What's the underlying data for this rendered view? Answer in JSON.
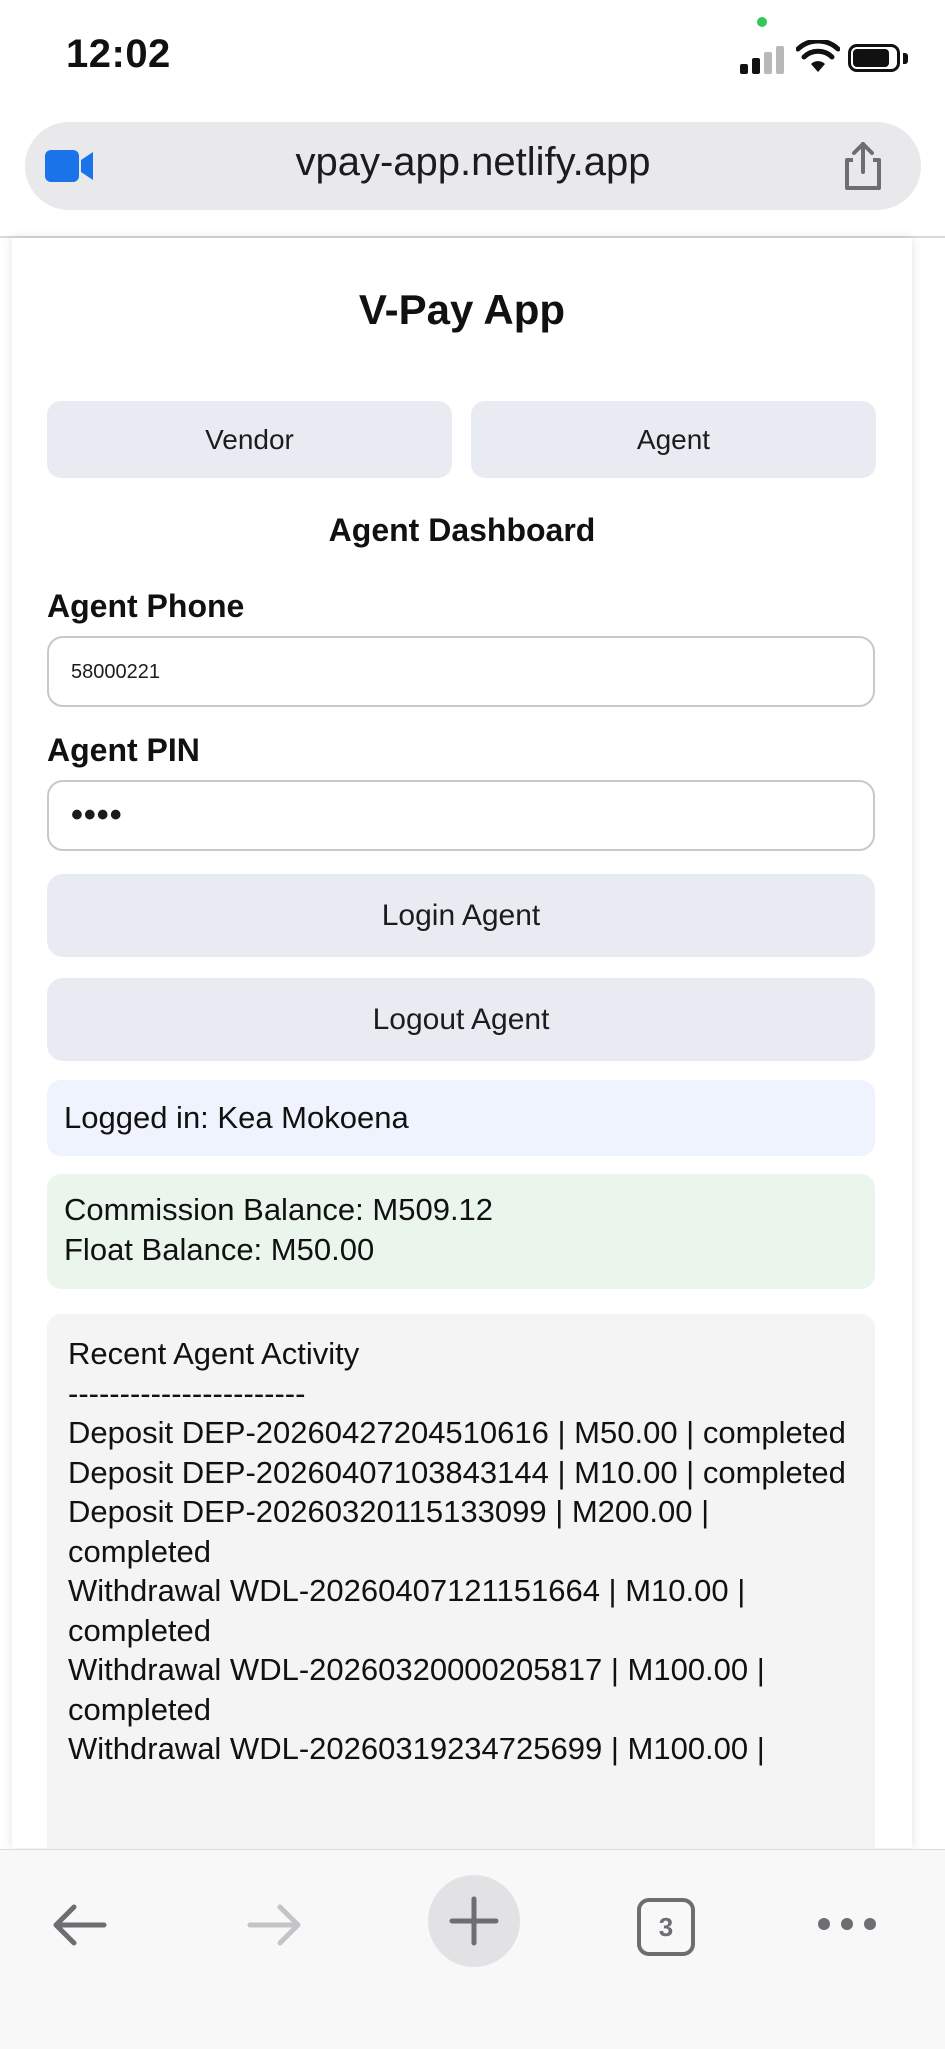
{
  "status_bar": {
    "time": "12:02"
  },
  "browser": {
    "url": "vpay-app.netlify.app",
    "tab_count": "3"
  },
  "app": {
    "title": "V-Pay App",
    "tabs": [
      {
        "label": "Vendor"
      },
      {
        "label": "Agent"
      }
    ],
    "dashboard_title": "Agent Dashboard",
    "phone": {
      "label": "Agent Phone",
      "value": "58000221"
    },
    "pin": {
      "label": "Agent PIN",
      "value": "••••"
    },
    "login_button": "Login Agent",
    "logout_button": "Logout Agent",
    "logged_in_text": "Logged in: Kea Mokoena",
    "commission_balance": "Commission Balance: M509.12",
    "float_balance": "Float Balance: M50.00",
    "activity": {
      "title": "Recent Agent Activity",
      "separator": "-----------------------",
      "lines": [
        "Deposit DEP-20260427204510616 | M50.00 | completed",
        "Deposit DEP-20260407103843144 | M10.00 | completed",
        "Deposit DEP-20260320115133099 | M200.00 | completed",
        "Withdrawal WDL-20260407121151664 | M10.00 | completed",
        "Withdrawal WDL-20260320000205817 | M100.00 | completed",
        "Withdrawal WDL-20260319234725699 | M100.00 |"
      ]
    }
  },
  "colors": {
    "button_bg": "#e8ebf1",
    "logged_in_bg": "#eef3fe",
    "balance_bg": "#eaf6ec",
    "activity_bg": "#f4f4f5",
    "meet_blue": "#1a73e8"
  },
  "icons": {
    "status": [
      "signal-icon",
      "wifi-icon",
      "battery-icon"
    ],
    "toolbar": [
      "back-arrow-icon",
      "forward-arrow-icon",
      "plus-icon",
      "tabs-icon",
      "more-icon"
    ],
    "url_bar": [
      "video-camera-icon",
      "share-icon"
    ]
  }
}
